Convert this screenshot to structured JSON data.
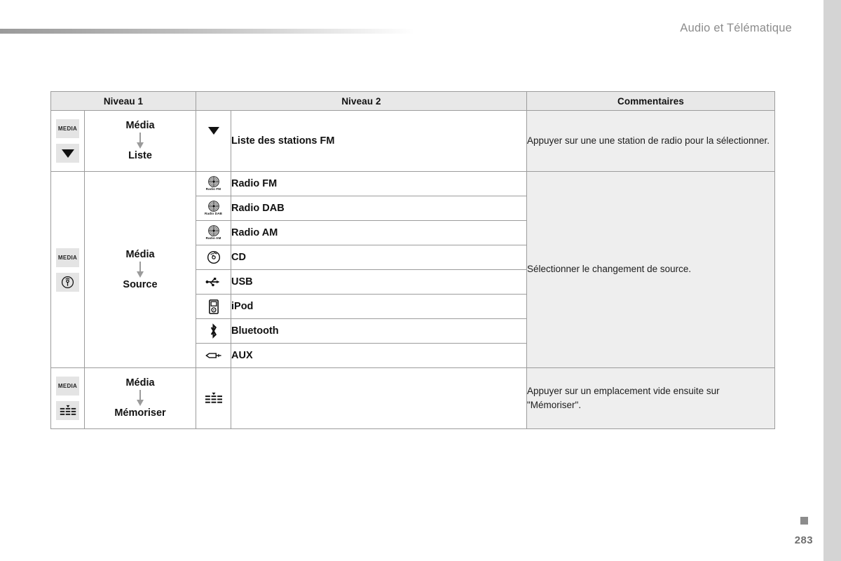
{
  "header": {
    "title": "Audio et Télématique"
  },
  "footer": {
    "page_number": "283",
    "marker_color": "#8c8c8c"
  },
  "table": {
    "headers": {
      "level1": "Niveau 1",
      "level2": "Niveau 2",
      "comments": "Commentaires"
    },
    "rows": [
      {
        "key_label": "MEDIA",
        "key_icon": "triangle-down-icon",
        "flow_from": "Média",
        "flow_to": "Liste",
        "level2_items": [
          {
            "icon": "triangle-down-icon",
            "label": "Liste des stations FM"
          }
        ],
        "comment": "Appuyer sur une une station de radio pour la sélectionner."
      },
      {
        "key_label": "MEDIA",
        "key_icon": "source-antenna-icon",
        "flow_from": "Média",
        "flow_to": "Source",
        "level2_items": [
          {
            "icon": "radio-disc-icon",
            "icon_caption": "Radio FM",
            "label": "Radio FM"
          },
          {
            "icon": "radio-disc-icon",
            "icon_caption": "Radio DAB",
            "label": "Radio DAB"
          },
          {
            "icon": "radio-disc-icon",
            "icon_caption": "Radio AM",
            "label": "Radio AM"
          },
          {
            "icon": "cd-disc-icon",
            "label": "CD"
          },
          {
            "icon": "usb-icon",
            "label": "USB"
          },
          {
            "icon": "ipod-icon",
            "label": "iPod"
          },
          {
            "icon": "bluetooth-icon",
            "label": "Bluetooth"
          },
          {
            "icon": "aux-jack-icon",
            "label": "AUX"
          }
        ],
        "comment": "Sélectionner le changement de source."
      },
      {
        "key_label": "MEDIA",
        "key_icon": "memorise-list-icon",
        "flow_from": "Média",
        "flow_to": "Mémoriser",
        "level2_items": [
          {
            "icon": "memorise-list-icon",
            "label": ""
          }
        ],
        "comment": "Appuyer sur un emplacement vide ensuite sur \"Mémoriser\"."
      }
    ]
  },
  "colors": {
    "header_band": "#e8e8e8",
    "comment_cell": "#eeeeee",
    "key_button": "#e4e4e4",
    "border": "#9c9c9c",
    "arrow": "#9b9b9b",
    "title_text": "#8c8c8c"
  }
}
